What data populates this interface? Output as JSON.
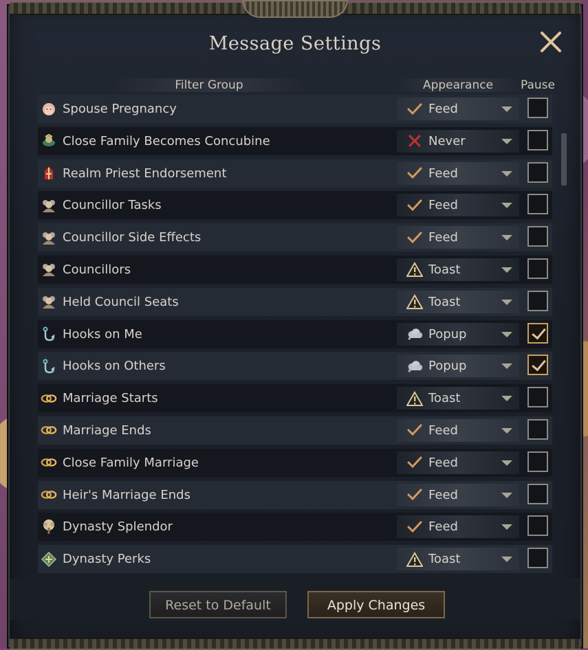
{
  "window": {
    "title": "Message Settings"
  },
  "headers": {
    "filter_group": "Filter Group",
    "appearance": "Appearance",
    "pause": "Pause"
  },
  "rows": [
    {
      "label": "Spouse Pregnancy",
      "icon": "baby-icon",
      "appearance": "Feed",
      "appearance_icon": "checkmark-icon",
      "pause": false
    },
    {
      "label": "Close Family Becomes Concubine",
      "icon": "concubine-icon",
      "appearance": "Never",
      "appearance_icon": "cross-icon",
      "pause": false
    },
    {
      "label": "Realm Priest Endorsement",
      "icon": "mitre-icon",
      "appearance": "Feed",
      "appearance_icon": "checkmark-icon",
      "pause": false
    },
    {
      "label": "Councillor Tasks",
      "icon": "council-icon",
      "appearance": "Feed",
      "appearance_icon": "checkmark-icon",
      "pause": false
    },
    {
      "label": "Councillor Side Effects",
      "icon": "council-icon",
      "appearance": "Feed",
      "appearance_icon": "checkmark-icon",
      "pause": false
    },
    {
      "label": "Councillors",
      "icon": "council-icon",
      "appearance": "Toast",
      "appearance_icon": "warning-icon",
      "pause": false
    },
    {
      "label": "Held Council Seats",
      "icon": "council-icon",
      "appearance": "Toast",
      "appearance_icon": "warning-icon",
      "pause": false
    },
    {
      "label": "Hooks on Me",
      "icon": "hook-icon",
      "appearance": "Popup",
      "appearance_icon": "cloud-icon",
      "pause": true
    },
    {
      "label": "Hooks on Others",
      "icon": "hook-icon",
      "appearance": "Popup",
      "appearance_icon": "cloud-icon",
      "pause": true
    },
    {
      "label": "Marriage Starts",
      "icon": "rings-icon",
      "appearance": "Toast",
      "appearance_icon": "warning-icon",
      "pause": false
    },
    {
      "label": "Marriage Ends",
      "icon": "rings-icon",
      "appearance": "Feed",
      "appearance_icon": "checkmark-icon",
      "pause": false
    },
    {
      "label": "Close Family Marriage",
      "icon": "rings-icon",
      "appearance": "Feed",
      "appearance_icon": "checkmark-icon",
      "pause": false
    },
    {
      "label": "Heir's Marriage Ends",
      "icon": "rings-icon",
      "appearance": "Feed",
      "appearance_icon": "checkmark-icon",
      "pause": false
    },
    {
      "label": "Dynasty Splendor",
      "icon": "tree-icon",
      "appearance": "Feed",
      "appearance_icon": "checkmark-icon",
      "pause": false
    },
    {
      "label": "Dynasty Perks",
      "icon": "perk-icon",
      "appearance": "Toast",
      "appearance_icon": "warning-icon",
      "pause": false
    }
  ],
  "buttons": {
    "reset": "Reset to Default",
    "apply": "Apply Changes"
  },
  "colors": {
    "check": "#d39a5e",
    "cross": "#c0332e",
    "accent": "#c9a064"
  }
}
